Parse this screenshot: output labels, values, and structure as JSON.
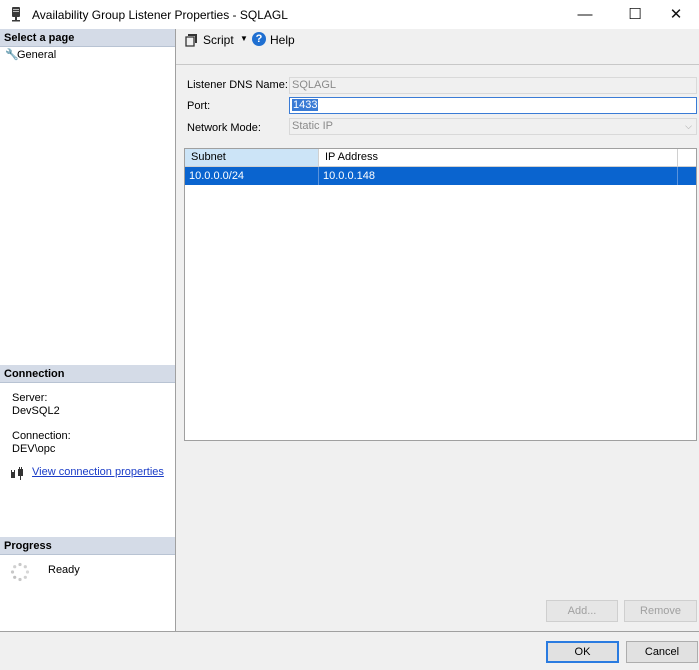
{
  "window": {
    "title": "Availability Group Listener Properties - SQLAGL",
    "minimize": "—",
    "maximize": "☐",
    "close": "✕"
  },
  "left_panel": {
    "select_page_header": "Select a page",
    "pages": [
      {
        "label": "General",
        "icon": "wrench-icon"
      }
    ],
    "connection_header": "Connection",
    "server_label": "Server:",
    "server_value": "DevSQL2",
    "connection_label": "Connection:",
    "connection_value": "DEV\\opc",
    "view_connection_link": "View connection properties",
    "progress_header": "Progress",
    "progress_status": "Ready"
  },
  "toolbar": {
    "script_label": "Script",
    "help_label": "Help"
  },
  "form": {
    "dns_label": "Listener DNS Name:",
    "dns_value": "SQLAGL",
    "port_label": "Port:",
    "port_value": "1433",
    "mode_label": "Network Mode:",
    "mode_value": "Static IP"
  },
  "grid": {
    "columns": [
      "Subnet",
      "IP Address"
    ],
    "rows": [
      {
        "subnet": "10.0.0.0/24",
        "ip": "10.0.0.148",
        "selected": true
      }
    ]
  },
  "buttons": {
    "add": "Add...",
    "remove": "Remove",
    "ok": "OK",
    "cancel": "Cancel"
  },
  "colors": {
    "selection": "#0a64cf",
    "header_band": "#d4dbe7",
    "link": "#1a3cc7"
  }
}
